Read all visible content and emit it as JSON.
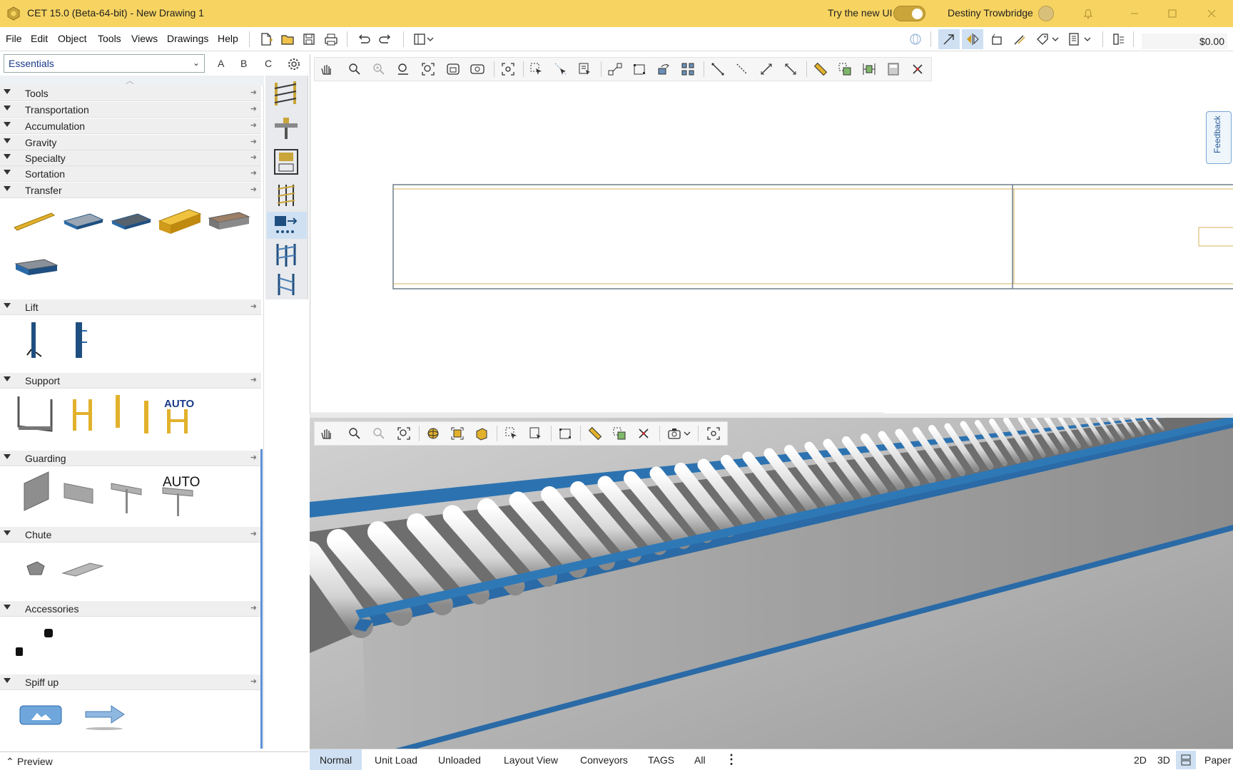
{
  "window": {
    "title": "CET 15.0 (Beta-64-bit) - New Drawing 1",
    "try_new_ui": "Try the new UI",
    "user_name": "Destiny Trowbridge",
    "accent_color": "#f7d461"
  },
  "menu": {
    "items": [
      "File",
      "Edit",
      "Object",
      "Tools",
      "Views",
      "Drawings",
      "Help"
    ]
  },
  "toolbar": {
    "price": "$0.00"
  },
  "library": {
    "selected": "Essentials",
    "tabs": [
      "A",
      "B",
      "C"
    ],
    "categories": [
      {
        "label": "Tools"
      },
      {
        "label": "Transportation"
      },
      {
        "label": "Accumulation"
      },
      {
        "label": "Gravity"
      },
      {
        "label": "Specialty"
      },
      {
        "label": "Sortation"
      },
      {
        "label": "Transfer"
      },
      {
        "label": "Lift"
      },
      {
        "label": "Support"
      },
      {
        "label": "Guarding"
      },
      {
        "label": "Chute"
      },
      {
        "label": "Accessories"
      },
      {
        "label": "Spiff up"
      }
    ],
    "auto_label": "AUTO",
    "preview_label": "Preview"
  },
  "views": {
    "feedback": "Feedback"
  },
  "bottom_tabs": {
    "tabs": [
      "Normal",
      "Unit Load",
      "Unloaded",
      "Layout View",
      "Conveyors",
      "TAGS",
      "All"
    ],
    "active": "Normal",
    "right": {
      "twod": "2D",
      "threed": "3D",
      "paper": "Paper"
    }
  }
}
